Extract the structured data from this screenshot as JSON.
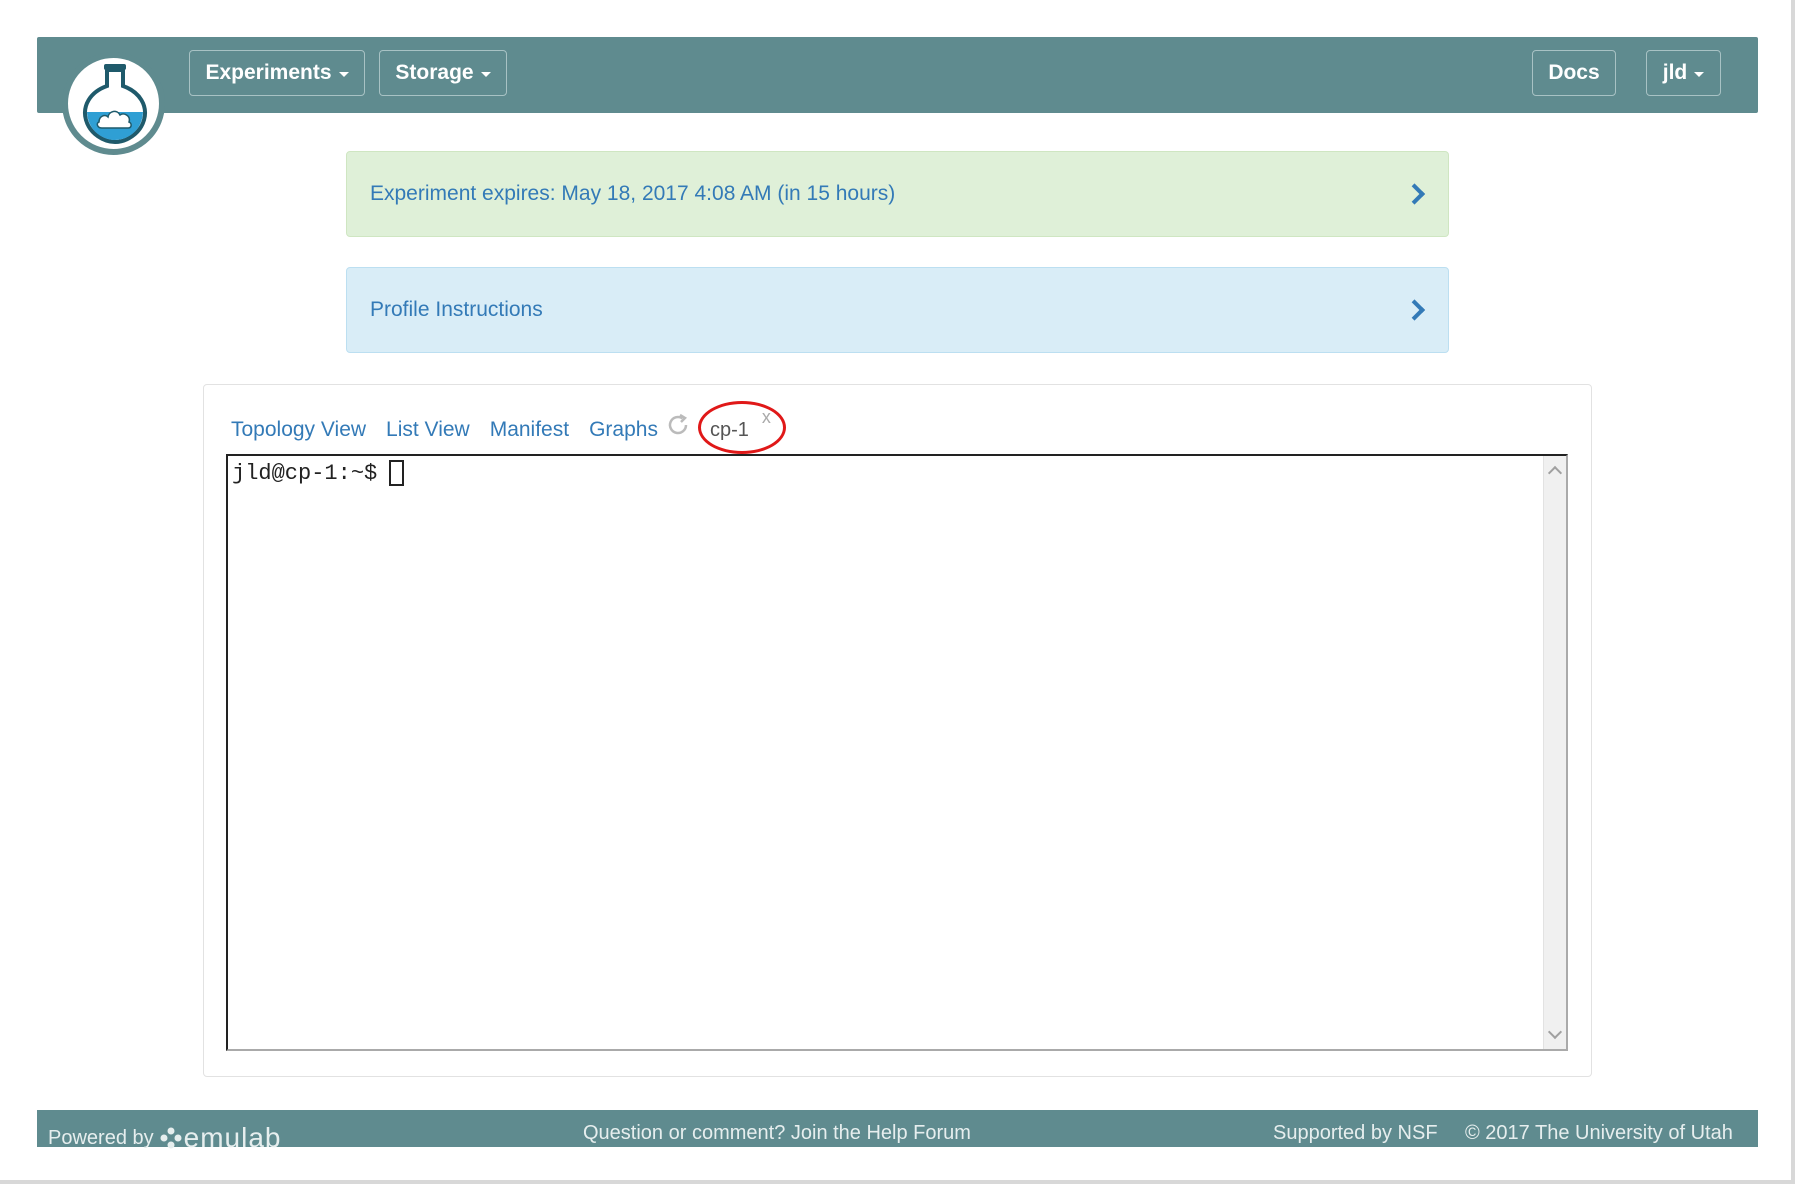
{
  "navbar": {
    "experiments_label": "Experiments",
    "storage_label": "Storage",
    "docs_label": "Docs",
    "user_label": "jld"
  },
  "panels": {
    "expires_text": "Experiment expires: May 18, 2017 4:08 AM (in 15 hours)",
    "profile_text": "Profile Instructions"
  },
  "tabs": {
    "topology": "Topology View",
    "list": "List View",
    "manifest": "Manifest",
    "graphs": "Graphs",
    "active": "cp-1",
    "close": "x"
  },
  "terminal": {
    "prompt": "jld@cp-1:~$"
  },
  "footer": {
    "powered_by": "Powered by",
    "brand": "emulab",
    "help": "Question or comment? Join the Help Forum",
    "nsf": "Supported by NSF",
    "copyright": "© 2017 The University of Utah"
  },
  "colors": {
    "navbar": "#5f8b8f",
    "link": "#337ab7",
    "success_bg": "#dff0d8",
    "info_bg": "#d9edf7",
    "annotation": "#e01818"
  },
  "icons": {
    "logo": "flask-cloud-icon",
    "refresh": "refresh-icon",
    "chevron": "chevron-right-icon"
  }
}
